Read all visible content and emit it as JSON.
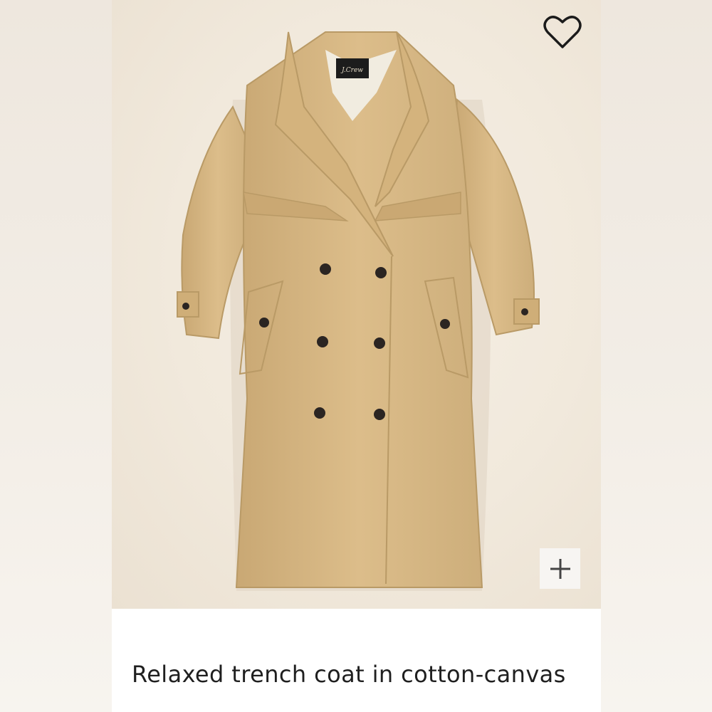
{
  "product": {
    "title": "Relaxed trench coat in cotton-canvas",
    "image_label": "J.Crew"
  },
  "actions": {
    "wishlist_icon": "heart-outline-icon",
    "zoom_icon": "plus-icon"
  },
  "colors": {
    "coat": "#d8b883",
    "coat_shadow": "#bfa06d",
    "buttons": "#2b2522",
    "background": "#efe9e1"
  }
}
